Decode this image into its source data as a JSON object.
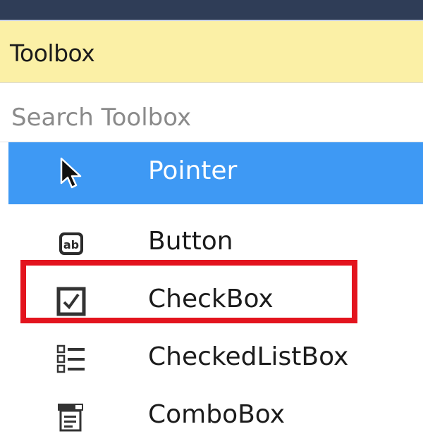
{
  "panel": {
    "title": "Toolbox"
  },
  "search": {
    "placeholder": "Search Toolbox"
  },
  "items": [
    {
      "label": "Pointer",
      "icon": "pointer-arrow-icon",
      "selected": true
    },
    {
      "label": "Button",
      "icon": "button-ab-icon",
      "selected": false
    },
    {
      "label": "CheckBox",
      "icon": "checkbox-icon",
      "selected": false,
      "highlighted": true
    },
    {
      "label": "CheckedListBox",
      "icon": "checked-list-box-icon",
      "selected": false
    },
    {
      "label": "ComboBox",
      "icon": "combo-box-icon",
      "selected": false
    }
  ],
  "colors": {
    "header_bg": "#fbf0a6",
    "top_strip": "#2f3d57",
    "selection": "#3e99f4",
    "highlight_border": "#e3141e"
  }
}
